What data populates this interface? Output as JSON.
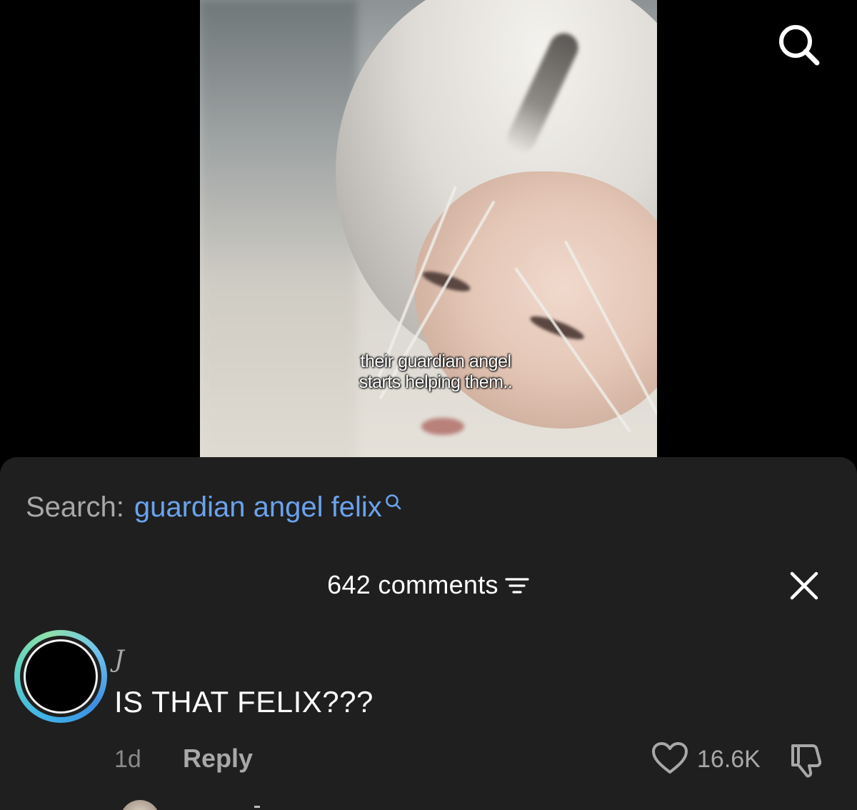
{
  "video": {
    "caption": "their guardian angel starts helping them.."
  },
  "top_bar": {
    "search_icon": "search-icon"
  },
  "sheet": {
    "search_label": "Search:",
    "search_term": "guardian angel felix",
    "comments_count": "642 comments",
    "filter_icon": "filter-icon",
    "close_icon": "close-icon"
  },
  "comment": {
    "username": "J",
    "text": "IS THAT FELIX???",
    "time": "1d",
    "reply_label": "Reply",
    "likes": "16.6K",
    "like_icon": "heart-icon",
    "dislike_icon": "thumbs-down-icon"
  },
  "colors": {
    "sheet_bg": "#1f1f1f",
    "search_link": "#6aa3ee",
    "muted_text": "#a8a8a8",
    "avatar_ring": "#3fb2e8"
  }
}
